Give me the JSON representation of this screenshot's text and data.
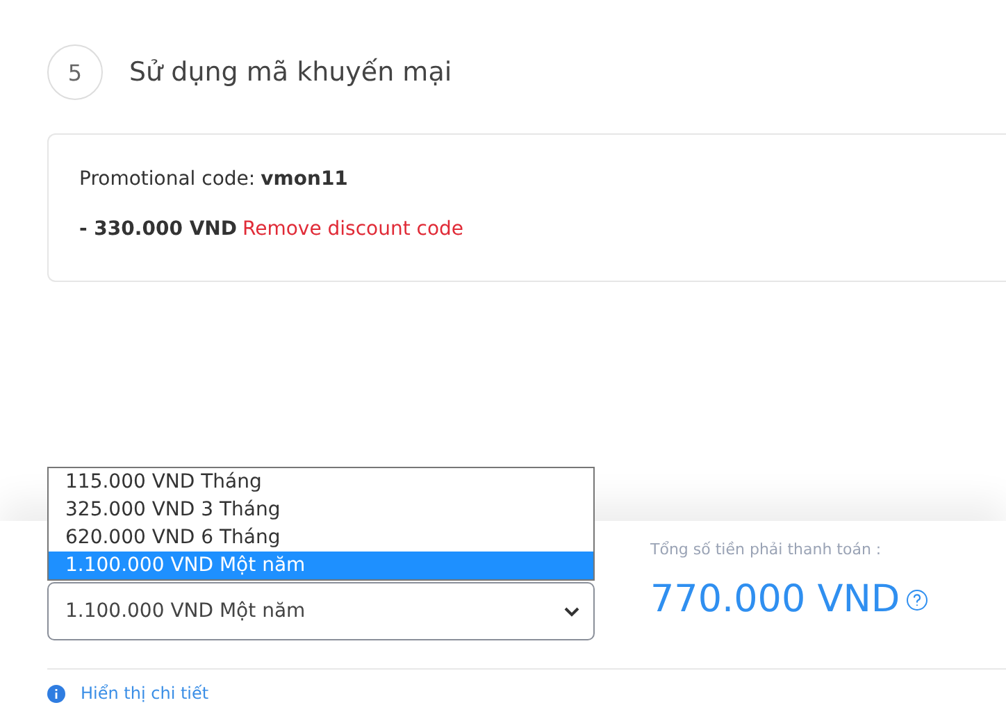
{
  "step": {
    "number": "5",
    "title": "Sử dụng mã khuyến mại"
  },
  "promo": {
    "label": "Promotional code:",
    "code": "vmon11",
    "discount": "- 330.000 VND",
    "remove_link": "Remove discount code"
  },
  "plan_select": {
    "value": "1.100.000 VND Một năm",
    "options": [
      {
        "label": "115.000 VND Tháng",
        "selected": false
      },
      {
        "label": "325.000 VND 3 Tháng",
        "selected": false
      },
      {
        "label": "620.000 VND 6 Tháng",
        "selected": false
      },
      {
        "label": "1.100.000 VND Một năm",
        "selected": true
      }
    ]
  },
  "total": {
    "label": "Tổng số tiền phải thanh toán :",
    "amount": "770.000 VND"
  },
  "details_link": "Hiển thị chi tiết"
}
